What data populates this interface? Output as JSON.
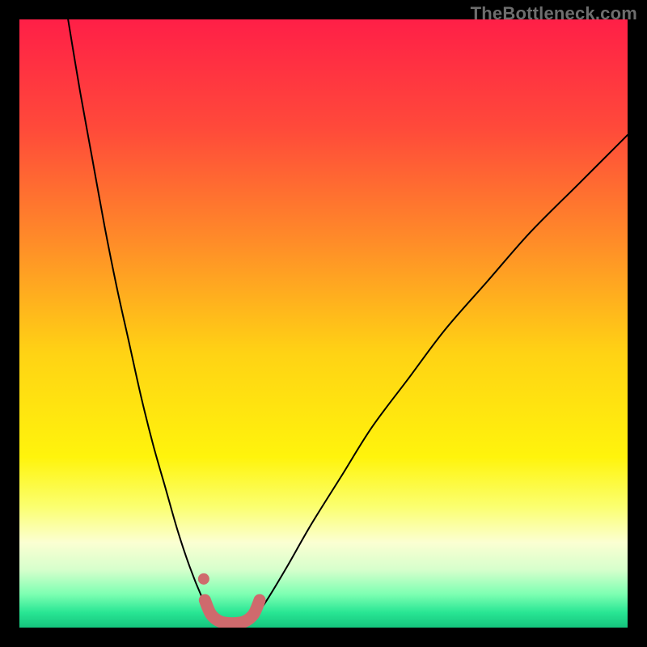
{
  "watermark": "TheBottleneck.com",
  "chart_data": {
    "type": "line",
    "title": "",
    "xlabel": "",
    "ylabel": "",
    "xlim": [
      0,
      100
    ],
    "ylim": [
      0,
      100
    ],
    "grid": false,
    "legend": false,
    "background_gradient": {
      "stops": [
        {
          "offset": 0.0,
          "color": "#ff1f47"
        },
        {
          "offset": 0.18,
          "color": "#ff4a3a"
        },
        {
          "offset": 0.36,
          "color": "#ff8a29"
        },
        {
          "offset": 0.55,
          "color": "#ffd314"
        },
        {
          "offset": 0.72,
          "color": "#fff40c"
        },
        {
          "offset": 0.8,
          "color": "#fbff6e"
        },
        {
          "offset": 0.86,
          "color": "#fbffd2"
        },
        {
          "offset": 0.905,
          "color": "#d6ffcc"
        },
        {
          "offset": 0.945,
          "color": "#7dffb2"
        },
        {
          "offset": 0.975,
          "color": "#29e694"
        },
        {
          "offset": 1.0,
          "color": "#14c47d"
        }
      ]
    },
    "series": [
      {
        "name": "left-branch",
        "kind": "curve",
        "x": [
          8,
          10,
          12,
          14,
          16,
          18,
          20,
          22,
          24,
          26,
          28,
          30,
          31.5
        ],
        "y": [
          100,
          88,
          77,
          66,
          56,
          47,
          38,
          30,
          23,
          16,
          10,
          5,
          2
        ]
      },
      {
        "name": "right-branch",
        "kind": "curve",
        "x": [
          39,
          41,
          44,
          48,
          53,
          58,
          64,
          70,
          77,
          84,
          92,
          100
        ],
        "y": [
          2,
          5,
          10,
          17,
          25,
          33,
          41,
          49,
          57,
          65,
          73,
          81
        ]
      },
      {
        "name": "valley-marker",
        "kind": "rounded-path",
        "x": [
          30.5,
          31.5,
          33,
          35,
          37,
          38.5,
          39.5
        ],
        "y": [
          4.5,
          2.2,
          1.0,
          0.7,
          1.0,
          2.2,
          4.5
        ]
      }
    ],
    "points": [
      {
        "name": "marker-dot",
        "x": 30.3,
        "y": 8.0
      }
    ],
    "colors": {
      "curve": "#000000",
      "marker": "#cf6a6d"
    }
  }
}
